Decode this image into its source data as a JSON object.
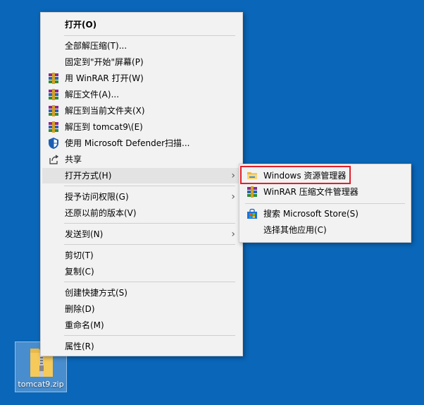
{
  "desktop": {
    "file_name": "tomcat9.zip",
    "file_icon": "zip-folder-icon"
  },
  "context_menu": {
    "open": "打开(O)",
    "extract_all": "全部解压缩(T)...",
    "pin_start": "固定到\"开始\"屏幕(P)",
    "winrar_open": "用 WinRAR 打开(W)",
    "extract_files": "解压文件(A)...",
    "extract_here": "解压到当前文件夹(X)",
    "extract_to": "解压到 tomcat9\\(E)",
    "defender_scan": "使用 Microsoft Defender扫描...",
    "share": "共享",
    "open_with": "打开方式(H)",
    "give_access": "授予访问权限(G)",
    "restore_previous": "还原以前的版本(V)",
    "send_to": "发送到(N)",
    "cut": "剪切(T)",
    "copy": "复制(C)",
    "create_shortcut": "创建快捷方式(S)",
    "delete": "删除(D)",
    "rename": "重命名(M)",
    "properties": "属性(R)"
  },
  "open_with_submenu": {
    "explorer": "Windows 资源管理器",
    "winrar_manager": "WinRAR 压缩文件管理器",
    "search_store": "搜索 Microsoft Store(S)",
    "choose_other": "选择其他应用(C)"
  },
  "colors": {
    "desktop_bg": "#0a66b8",
    "menu_bg": "#f2f2f2",
    "highlight_border": "#e0202a"
  }
}
